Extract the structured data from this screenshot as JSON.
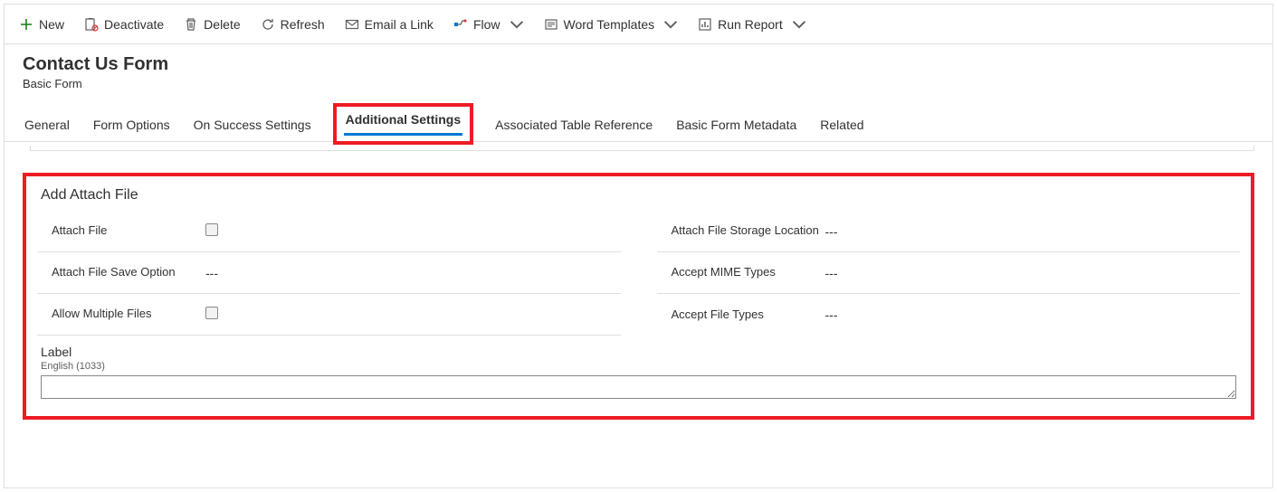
{
  "commands": {
    "new": "New",
    "deactivate": "Deactivate",
    "delete": "Delete",
    "refresh": "Refresh",
    "email_link": "Email a Link",
    "flow": "Flow",
    "word_templates": "Word Templates",
    "run_report": "Run Report"
  },
  "header": {
    "title": "Contact Us Form",
    "subtitle": "Basic Form"
  },
  "tabs": {
    "general": "General",
    "form_options": "Form Options",
    "on_success": "On Success Settings",
    "additional": "Additional Settings",
    "assoc_ref": "Associated Table Reference",
    "metadata": "Basic Form Metadata",
    "related": "Related"
  },
  "section": {
    "title": "Add Attach File",
    "left": {
      "attach_file_label": "Attach File",
      "save_option_label": "Attach File Save Option",
      "save_option_value": "---",
      "allow_multi_label": "Allow Multiple Files"
    },
    "right": {
      "storage_label": "Attach File Storage Location",
      "storage_value": "---",
      "mime_label": "Accept MIME Types",
      "mime_value": "---",
      "filetypes_label": "Accept File Types",
      "filetypes_value": "---"
    },
    "label_block": {
      "label": "Label",
      "lang": "English (1033)",
      "value": ""
    }
  }
}
